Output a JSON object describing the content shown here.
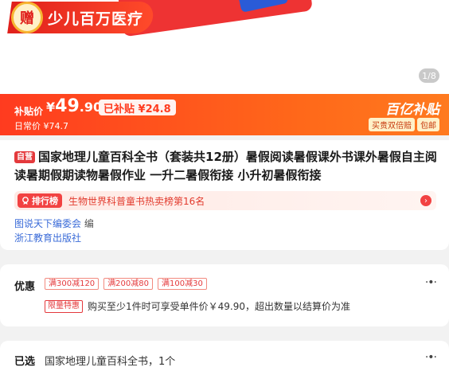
{
  "hero": {
    "gift_badge": "赠",
    "gift_text": "少儿百万医疗",
    "page_indicator": "1/8"
  },
  "price": {
    "label": "补贴价",
    "currency": "¥",
    "integer": "49",
    "decimal": ".90",
    "subsidy": "已补贴 ¥24.8",
    "original": "日常价 ¥74.7",
    "brand": "百亿补贴",
    "tags": [
      "买贵双倍赔",
      "包邮"
    ]
  },
  "product": {
    "badge": "自营",
    "title": "国家地理儿童百科全书（套装共12册）暑假阅读暑假课外书课外暑假自主阅读暑期假期读物暑假作业 一升二暑假衔接 小升初暑假衔接",
    "rank_badge": "排行榜",
    "rank_text": "生物世界科普童书热卖榜第16名",
    "author": "图说天下编委会",
    "author_suffix": " 编",
    "publisher": "浙江教育出版社"
  },
  "promo": {
    "label": "优惠",
    "coupons": [
      "满300减120",
      "满200减80",
      "满100减30"
    ],
    "limit_badge": "限量特惠",
    "limit_text": "购买至少1件时可享受单件价￥49.90，超出数量以结算价为准"
  },
  "selected": {
    "label": "已选",
    "value": "国家地理儿童百科全书，1个"
  },
  "colors": {
    "accent": "#ff3b1f",
    "brand_red": "#e4393c",
    "link_blue": "#3a6bd8"
  }
}
